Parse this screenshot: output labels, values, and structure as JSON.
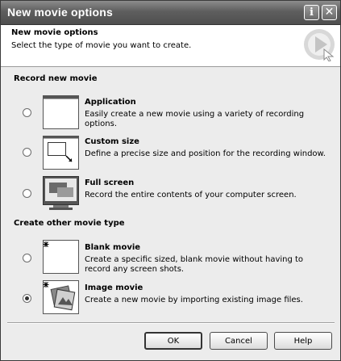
{
  "window": {
    "title": "New movie options"
  },
  "titlebar": {
    "info_glyph": "i",
    "close_glyph": "✕"
  },
  "header": {
    "title": "New movie options",
    "subtitle": "Select the type of movie you want to create.",
    "logo_icon": "play-arrow-logo-icon"
  },
  "groups": {
    "record": {
      "label": "Record new movie"
    },
    "other": {
      "label": "Create other movie type"
    }
  },
  "options": {
    "application": {
      "title": "Application",
      "description": "Easily create a new movie using a variety of recording options.",
      "icon": "application-window-icon",
      "selected": false
    },
    "custom_size": {
      "title": "Custom size",
      "description": "Define a precise size and position for the recording window.",
      "icon": "custom-size-icon",
      "selected": false
    },
    "full_screen": {
      "title": "Full screen",
      "description": "Record the entire contents of your computer screen.",
      "icon": "monitor-icon",
      "selected": false
    },
    "blank_movie": {
      "title": "Blank movie",
      "description": "Create a specific sized, blank movie without having to record any screen shots.",
      "icon": "blank-page-icon",
      "selected": false
    },
    "image_movie": {
      "title": "Image movie",
      "description": "Create a new movie by importing existing image files.",
      "icon": "image-photo-icon",
      "selected": true
    }
  },
  "buttons": {
    "ok": "OK",
    "cancel": "Cancel",
    "help": "Help"
  },
  "colors": {
    "titlebar": "#5e5e5e",
    "dialog_bg": "#ececec",
    "header_bg": "#ffffff"
  }
}
